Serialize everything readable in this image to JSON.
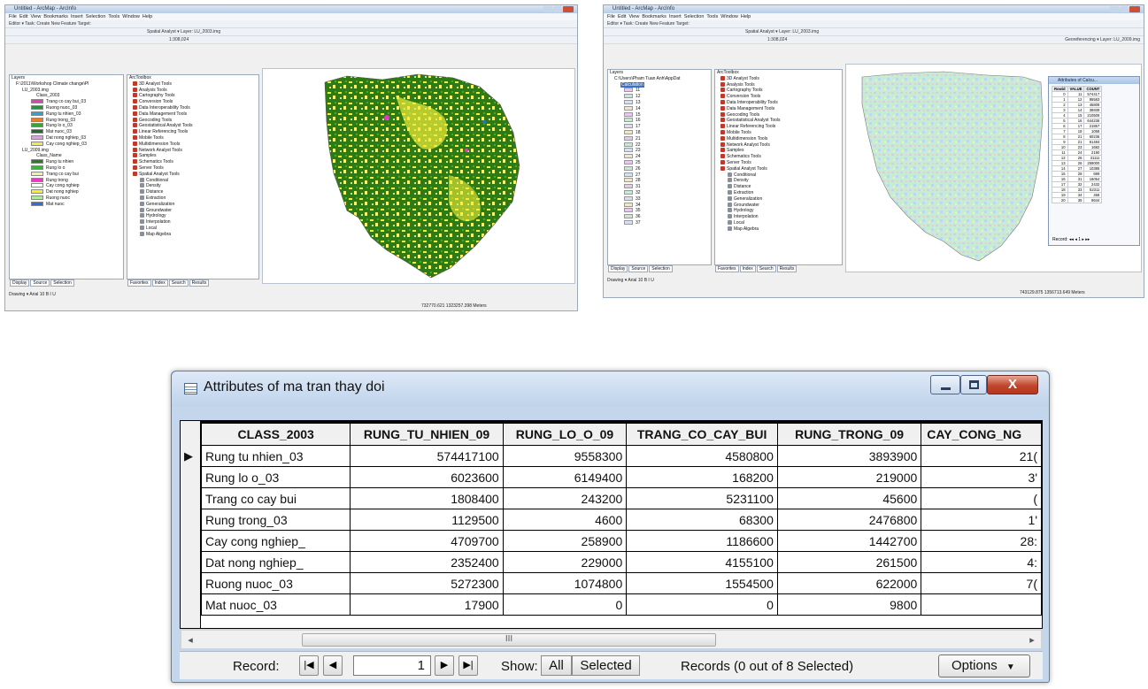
{
  "left_screenshot": {
    "title": "Untitled - ArcMap - ArcInfo",
    "menu": [
      "File",
      "Edit",
      "View",
      "Bookmarks",
      "Insert",
      "Selection",
      "Tools",
      "Window",
      "Help"
    ],
    "editor_toolbar": "Editor ▾  Task: Create New Feature     Target:",
    "tool_row2": "Spatial Analyst ▾  Layer: LU_2003.img",
    "tool_row3": "1:308,024",
    "toc": {
      "root": "Layers",
      "folder": "F:\\2011\\Workshop Climate change\\Pl",
      "layer1": "LU_2003.img",
      "layer1_field": "Class_2003",
      "layer1_classes": [
        {
          "label": "Trang co cay bui_03",
          "color": "#e63bbf"
        },
        {
          "label": "Ruong nuoc_03",
          "color": "#2f8b4a"
        },
        {
          "label": "Rung tu nhien_03",
          "color": "#2aa3d9"
        },
        {
          "label": "Rung trong_03",
          "color": "#e87d2a"
        },
        {
          "label": "Rung lo o_03",
          "color": "#3aa33a"
        },
        {
          "label": "Mat nuoc_03",
          "color": "#1f6b2e"
        },
        {
          "label": "Dat nong nghiep_03",
          "color": "#d9a3e0"
        },
        {
          "label": "Cay cong nghiep_03",
          "color": "#f2e85a"
        }
      ],
      "layer2": "LU_2009.img",
      "layer2_field": "Class_Name",
      "layer2_classes": [
        {
          "label": "Rung tu nhien",
          "color": "#2d7d1e"
        },
        {
          "label": "Rung lo o",
          "color": "#3fb23f"
        },
        {
          "label": "Trang co cay bui",
          "color": "#f1f1a6"
        },
        {
          "label": "Rung trong",
          "color": "#e63bbf"
        },
        {
          "label": "Cay cong nghiep",
          "color": "#ffffff"
        },
        {
          "label": "Dat nong nghiep",
          "color": "#f7f028"
        },
        {
          "label": "Ruong nuoc",
          "color": "#b6e89b"
        },
        {
          "label": "Mat nuoc",
          "color": "#2c6fd6"
        }
      ],
      "tabs": [
        "Display",
        "Source",
        "Selection"
      ]
    },
    "toolbox": {
      "root": "ArcToolbox",
      "items": [
        "3D Analyst Tools",
        "Analysis Tools",
        "Cartography Tools",
        "Conversion Tools",
        "Data Interoperability Tools",
        "Data Management Tools",
        "Geocoding Tools",
        "Geostatistical Analyst Tools",
        "Linear Referencing Tools",
        "Mobile Tools",
        "Multidimension Tools",
        "Network Analyst Tools",
        "Samples",
        "Schematics Tools",
        "Server Tools",
        "Spatial Analyst Tools"
      ],
      "sub_items": [
        "Conditional",
        "Density",
        "Distance",
        "Extraction",
        "Generalization",
        "Groundwater",
        "Hydrology",
        "Interpolation",
        "Local",
        "Map Algebra"
      ],
      "tabs": [
        "Favorites",
        "Index",
        "Search",
        "Results"
      ]
    },
    "drawing_toolbar": "Drawing ▾   Arial   10   B I U",
    "status": "732770.621  1323257.398 Meters"
  },
  "right_screenshot": {
    "title": "Untitled - ArcMap - ArcInfo",
    "menu": [
      "File",
      "Edit",
      "View",
      "Bookmarks",
      "Insert",
      "Selection",
      "Tools",
      "Window",
      "Help"
    ],
    "editor_toolbar": "Editor ▾  Task: Create New Feature     Target:",
    "tool_row2": "Spatial Analyst ▾  Layer: LU_2003.img",
    "tool_row3": "1:308,024",
    "georef": "Georeferencing ▾  Layer: LU_2009.img",
    "toc": {
      "root": "Layers",
      "folder": "C:\\Users\\Pham Tuan Anh\\AppDat",
      "layer": "Calculation",
      "values": [
        "11",
        "12",
        "13",
        "14",
        "15",
        "16",
        "17",
        "18",
        "21",
        "22",
        "23",
        "24",
        "25",
        "26",
        "27",
        "28",
        "31",
        "32",
        "33",
        "34",
        "35",
        "36",
        "37"
      ],
      "tabs": [
        "Display",
        "Source",
        "Selection"
      ]
    },
    "toolbox": {
      "root": "ArcToolbox",
      "items": [
        "3D Analyst Tools",
        "Analysis Tools",
        "Cartography Tools",
        "Conversion Tools",
        "Data Interoperability Tools",
        "Data Management Tools",
        "Geocoding Tools",
        "Geostatistical Analyst Tools",
        "Linear Referencing Tools",
        "Mobile Tools",
        "Multidimension Tools",
        "Network Analyst Tools",
        "Samples",
        "Schematics Tools",
        "Server Tools",
        "Spatial Analyst Tools"
      ],
      "sub_items": [
        "Conditional",
        "Density",
        "Distance",
        "Extraction",
        "Generalization",
        "Groundwater",
        "Hydrology",
        "Interpolation",
        "Local",
        "Map Algebra"
      ],
      "tabs": [
        "Favorites",
        "Index",
        "Search",
        "Results"
      ]
    },
    "mini_attr": {
      "title": "Attributes of Calcu...",
      "headers": [
        "Rowid",
        "VALUE",
        "COUNT"
      ],
      "rows": [
        [
          "0",
          "11",
          "574417"
        ],
        [
          "1",
          "12",
          "95583"
        ],
        [
          "2",
          "13",
          "45808"
        ],
        [
          "3",
          "14",
          "38939"
        ],
        [
          "4",
          "15",
          "210509"
        ],
        [
          "5",
          "16",
          "644236"
        ],
        [
          "6",
          "17",
          "21857"
        ],
        [
          "7",
          "18",
          "1058"
        ],
        [
          "8",
          "21",
          "60236"
        ],
        [
          "9",
          "21",
          "61484"
        ],
        [
          "10",
          "23",
          "1682"
        ],
        [
          "11",
          "24",
          "2190"
        ],
        [
          "12",
          "26",
          "31111"
        ],
        [
          "13",
          "26",
          "259000"
        ],
        [
          "14",
          "27",
          "10386"
        ],
        [
          "15",
          "28",
          "699"
        ],
        [
          "16",
          "31",
          "16054"
        ],
        [
          "17",
          "32",
          "2432"
        ],
        [
          "18",
          "33",
          "52311"
        ],
        [
          "19",
          "34",
          "458"
        ],
        [
          "20",
          "35",
          "8644"
        ]
      ],
      "record_label": "Record:",
      "record_value": "1"
    },
    "drawing_toolbar": "Drawing ▾   Arial   10   B I U",
    "status": "743129.875  1356713.649 Meters"
  },
  "attribute_window": {
    "title": "Attributes of ma tran thay doi",
    "columns": [
      "CLASS_2003",
      "RUNG_TU_NHIEN_09",
      "RUNG_LO_O_09",
      "TRANG_CO_CAY_BUI",
      "RUNG_TRONG_09",
      "CAY_CONG_NG"
    ],
    "rows": [
      [
        "Rung tu nhien_03",
        "574417100",
        "9558300",
        "4580800",
        "3893900",
        "21("
      ],
      [
        "Rung lo o_03",
        "6023600",
        "6149400",
        "168200",
        "219000",
        "3'"
      ],
      [
        "Trang co cay bui",
        "1808400",
        "243200",
        "5231100",
        "45600",
        "("
      ],
      [
        "Rung trong_03",
        "1129500",
        "4600",
        "68300",
        "2476800",
        "1'"
      ],
      [
        "Cay cong nghiep_",
        "4709700",
        "258900",
        "1186600",
        "1442700",
        "28:"
      ],
      [
        "Dat nong nghiep_",
        "2352400",
        "229000",
        "4155100",
        "261500",
        "4:"
      ],
      [
        "Ruong nuoc_03",
        "5272300",
        "1074800",
        "1554500",
        "622000",
        "7("
      ],
      [
        "Mat nuoc_03",
        "17900",
        "0",
        "0",
        "9800",
        ""
      ]
    ],
    "scroll_grip": "III",
    "record_label": "Record:",
    "record_value": "1",
    "show_label": "Show:",
    "show_all": "All",
    "show_selected": "Selected",
    "records_status": "Records (0 out of 8 Selected)",
    "options_label": "Options"
  }
}
